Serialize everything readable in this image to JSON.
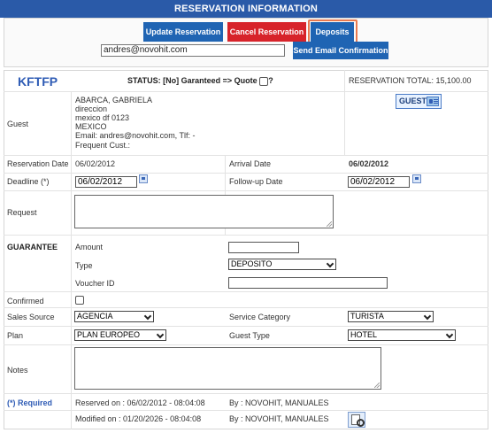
{
  "header": {
    "title": "RESERVATION INFORMATION"
  },
  "toolbar": {
    "update_label": "Update Reservation",
    "cancel_label": "Cancel Reservation",
    "deposits_label": "Deposits",
    "email_value": "andres@novohit.com",
    "send_email_label": "Send Email Confirmation"
  },
  "summary": {
    "code": "KFTFP",
    "status_text": "STATUS: [No] Garanteed => Quote",
    "status_suffix": "?",
    "total": "RESERVATION TOTAL: 15,100.00"
  },
  "guest": {
    "label": "Guest",
    "lines": [
      "ABARCA, GABRIELA",
      "direccion",
      "mexico df 0123",
      "MEXICO",
      "Email: andres@novohit.com, Tlf: -",
      "Frequent Cust.:"
    ],
    "button_label": "GUEST",
    "button_icon": "guest-card-icon"
  },
  "dates": {
    "reservation_date_label": "Reservation Date",
    "reservation_date": "06/02/2012",
    "arrival_date_label": "Arrival Date",
    "arrival_date": "06/02/2012",
    "deadline_label": "Deadline (*)",
    "deadline": "06/02/2012",
    "followup_label": "Follow-up Date",
    "followup": "06/02/2012"
  },
  "request": {
    "label": "Request",
    "value": ""
  },
  "guarantee": {
    "label": "GUARANTEE",
    "amount_label": "Amount",
    "amount_value": "",
    "type_label": "Type",
    "type_value": "DEPOSITO",
    "voucher_label": "Voucher ID",
    "voucher_value": ""
  },
  "confirmed": {
    "label": "Confirmed",
    "checked": false
  },
  "sales": {
    "source_label": "Sales Source",
    "source_value": "AGENCIA",
    "category_label": "Service Category",
    "category_value": "TURISTA",
    "plan_label": "Plan",
    "plan_value": "PLAN EUROPEO",
    "guest_type_label": "Guest Type",
    "guest_type_value": "HOTEL"
  },
  "notes": {
    "label": "Notes",
    "value": ""
  },
  "audit": {
    "required_label": "(*) Required",
    "reserved_on": "Reserved on : 06/02/2012 - 08:04:08",
    "reserved_by": "By : NOVOHIT, MANUALES",
    "modified_on": "Modified on : 01/20/2026 - 08:04:08",
    "modified_by": "By : NOVOHIT, MANUALES",
    "icon": "audit-log-icon"
  },
  "colors": {
    "header": "#2a5aa8",
    "primary_button": "#1f64b3",
    "danger_button": "#d7232a",
    "focus_ring": "#e8794f",
    "accent_text": "#2f5cb5"
  }
}
